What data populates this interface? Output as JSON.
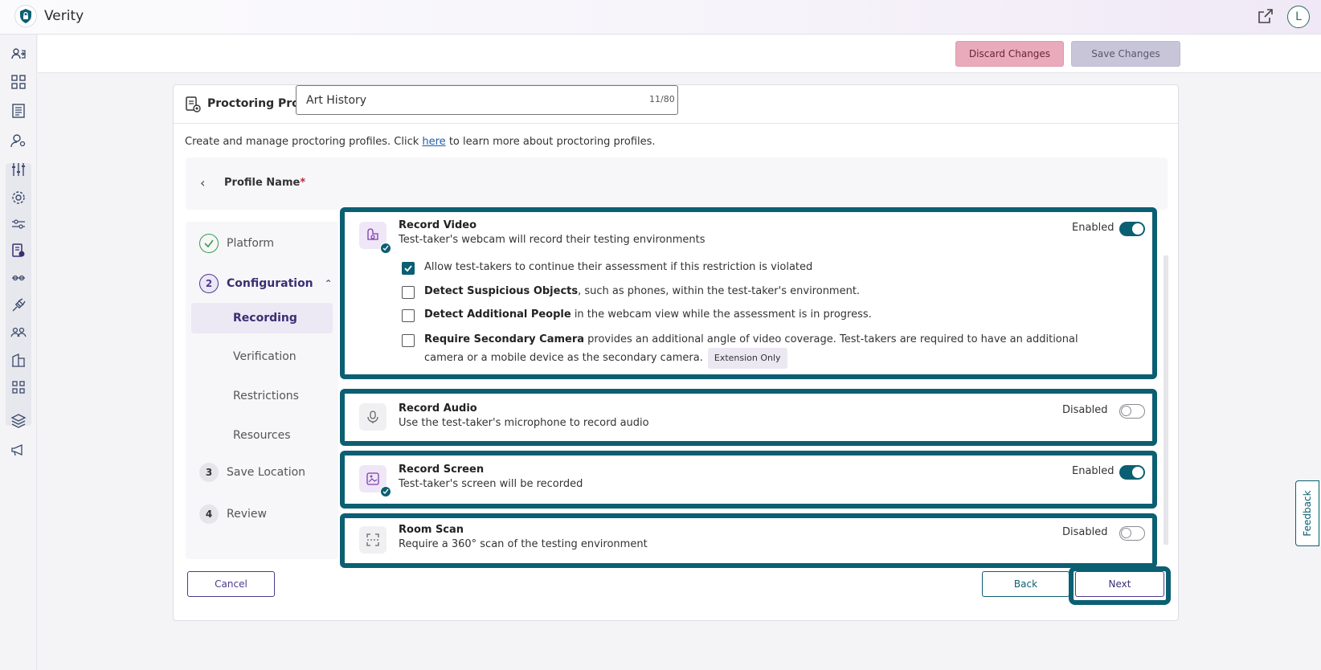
{
  "app": {
    "title": "Verity",
    "user_initial": "L"
  },
  "toolbar": {
    "discard_label": "Discard Changes",
    "save_label": "Save Changes"
  },
  "card": {
    "title": "Proctoring Profiles",
    "intro_before": "Create and manage proctoring profiles. Click ",
    "intro_link": "here",
    "intro_after": " to learn more about proctoring profiles."
  },
  "profile": {
    "label": "Profile Name",
    "required_mark": "*",
    "value": "Art History",
    "char_count": "11/80"
  },
  "steps": {
    "platform": {
      "label": "Platform"
    },
    "configuration": {
      "number": "2",
      "label": "Configuration"
    },
    "sub": [
      "Recording",
      "Verification",
      "Restrictions",
      "Resources"
    ],
    "save_location": {
      "number": "3",
      "label": "Save Location"
    },
    "review": {
      "number": "4",
      "label": "Review"
    }
  },
  "panels": {
    "record_video": {
      "title": "Record Video",
      "desc": "Test-taker's webcam will record their testing environments",
      "status": "Enabled",
      "options": [
        {
          "bold": "",
          "text": "Allow test-takers to continue their assessment if this restriction is violated",
          "checked": true
        },
        {
          "bold": "Detect Suspicious Objects",
          "text": ", such as phones, within the test-taker's environment.",
          "checked": false
        },
        {
          "bold": "Detect Additional People",
          "text": " in the webcam view while the assessment is in progress.",
          "checked": false
        },
        {
          "bold": "Require Secondary Camera",
          "text": " provides an additional angle of video coverage. Test-takers are required to have an additional camera or a mobile device as the secondary camera.",
          "checked": false,
          "badge": "Extension Only"
        }
      ]
    },
    "record_audio": {
      "title": "Record Audio",
      "desc": "Use the test-taker's microphone to record audio",
      "status": "Disabled"
    },
    "record_screen": {
      "title": "Record Screen",
      "desc": "Test-taker's screen will be recorded",
      "status": "Enabled"
    },
    "room_scan": {
      "title": "Room Scan",
      "desc": "Require a 360° scan of the testing environment",
      "status": "Disabled"
    }
  },
  "footer": {
    "cancel_label": "Cancel",
    "back_label": "Back",
    "next_label": "Next"
  },
  "feedback": {
    "label": "Feedback"
  },
  "colors": {
    "accent": "#0b5f72",
    "primary": "#4c3a8c",
    "discard": "#e9aabb"
  }
}
